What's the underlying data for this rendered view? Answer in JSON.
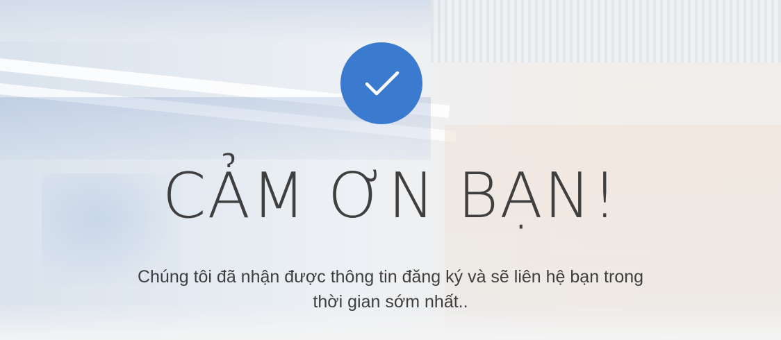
{
  "confirmation": {
    "icon": "checkmark-icon",
    "accent_color": "#3a7bd0",
    "title": "CẢM ƠN BẠN!",
    "message_line1": "Chúng tôi đã nhận được thông tin đăng ký và sẽ liên hệ bạn trong",
    "message_line2": "thời gian sớm nhất.."
  }
}
